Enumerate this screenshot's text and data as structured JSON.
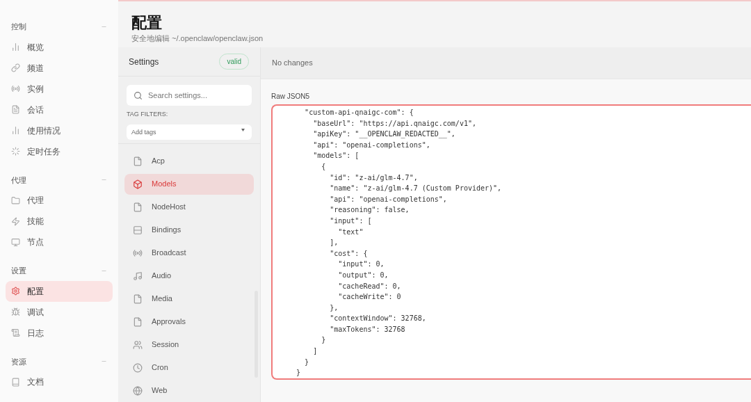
{
  "nav": [
    {
      "header": "控制",
      "items": [
        {
          "label": "概览",
          "selected": false
        },
        {
          "label": "频道",
          "selected": false
        },
        {
          "label": "实例",
          "selected": false
        },
        {
          "label": "会话",
          "selected": false
        },
        {
          "label": "使用情况",
          "selected": false
        },
        {
          "label": "定时任务",
          "selected": false
        }
      ]
    },
    {
      "header": "代理",
      "items": [
        {
          "label": "代理",
          "selected": false
        },
        {
          "label": "技能",
          "selected": false
        },
        {
          "label": "节点",
          "selected": false
        }
      ]
    },
    {
      "header": "设置",
      "items": [
        {
          "label": "配置",
          "selected": true
        },
        {
          "label": "调试",
          "selected": false
        },
        {
          "label": "日志",
          "selected": false
        }
      ]
    },
    {
      "header": "资源",
      "items": [
        {
          "label": "文档",
          "selected": false
        }
      ]
    }
  ],
  "page": {
    "title": "配置",
    "subtitle": "安全地编辑 ~/.openclaw/openclaw.json"
  },
  "settings": {
    "title": "Settings",
    "badge": "valid",
    "search": {
      "placeholder": "Search settings..."
    },
    "tag_filters_label": "TAG FILTERS:",
    "tags": {
      "placeholder": "Add tags"
    },
    "sections": [
      {
        "label": "Acp",
        "selected": false
      },
      {
        "label": "Models",
        "selected": true
      },
      {
        "label": "NodeHost",
        "selected": false
      },
      {
        "label": "Bindings",
        "selected": false
      },
      {
        "label": "Broadcast",
        "selected": false
      },
      {
        "label": "Audio",
        "selected": false
      },
      {
        "label": "Media",
        "selected": false
      },
      {
        "label": "Approvals",
        "selected": false
      },
      {
        "label": "Session",
        "selected": false
      },
      {
        "label": "Cron",
        "selected": false
      },
      {
        "label": "Web",
        "selected": false
      }
    ]
  },
  "status": "No changes",
  "editor": {
    "label": "Raw JSON5",
    "lines": [
      "      \"custom-api-qnaigc-com\": {",
      "        \"baseUrl\": \"https://api.qnaigc.com/v1\",",
      "        \"apiKey\": \"__OPENCLAW_REDACTED__\",",
      "        \"api\": \"openai-completions\",",
      "        \"models\": [",
      "          {",
      "            \"id\": \"z-ai/glm-4.7\",",
      "            \"name\": \"z-ai/glm-4.7 (Custom Provider)\",",
      "            \"api\": \"openai-completions\",",
      "            \"reasoning\": false,",
      "            \"input\": [",
      "              \"text\"",
      "            ],",
      "            \"cost\": {",
      "              \"input\": 0,",
      "              \"output\": 0,",
      "              \"cacheRead\": 0,",
      "              \"cacheWrite\": 0",
      "            },",
      "            \"contextWindow\": 32768,",
      "            \"maxTokens\": 32768",
      "          }",
      "        ]",
      "      }",
      "    }"
    ]
  }
}
